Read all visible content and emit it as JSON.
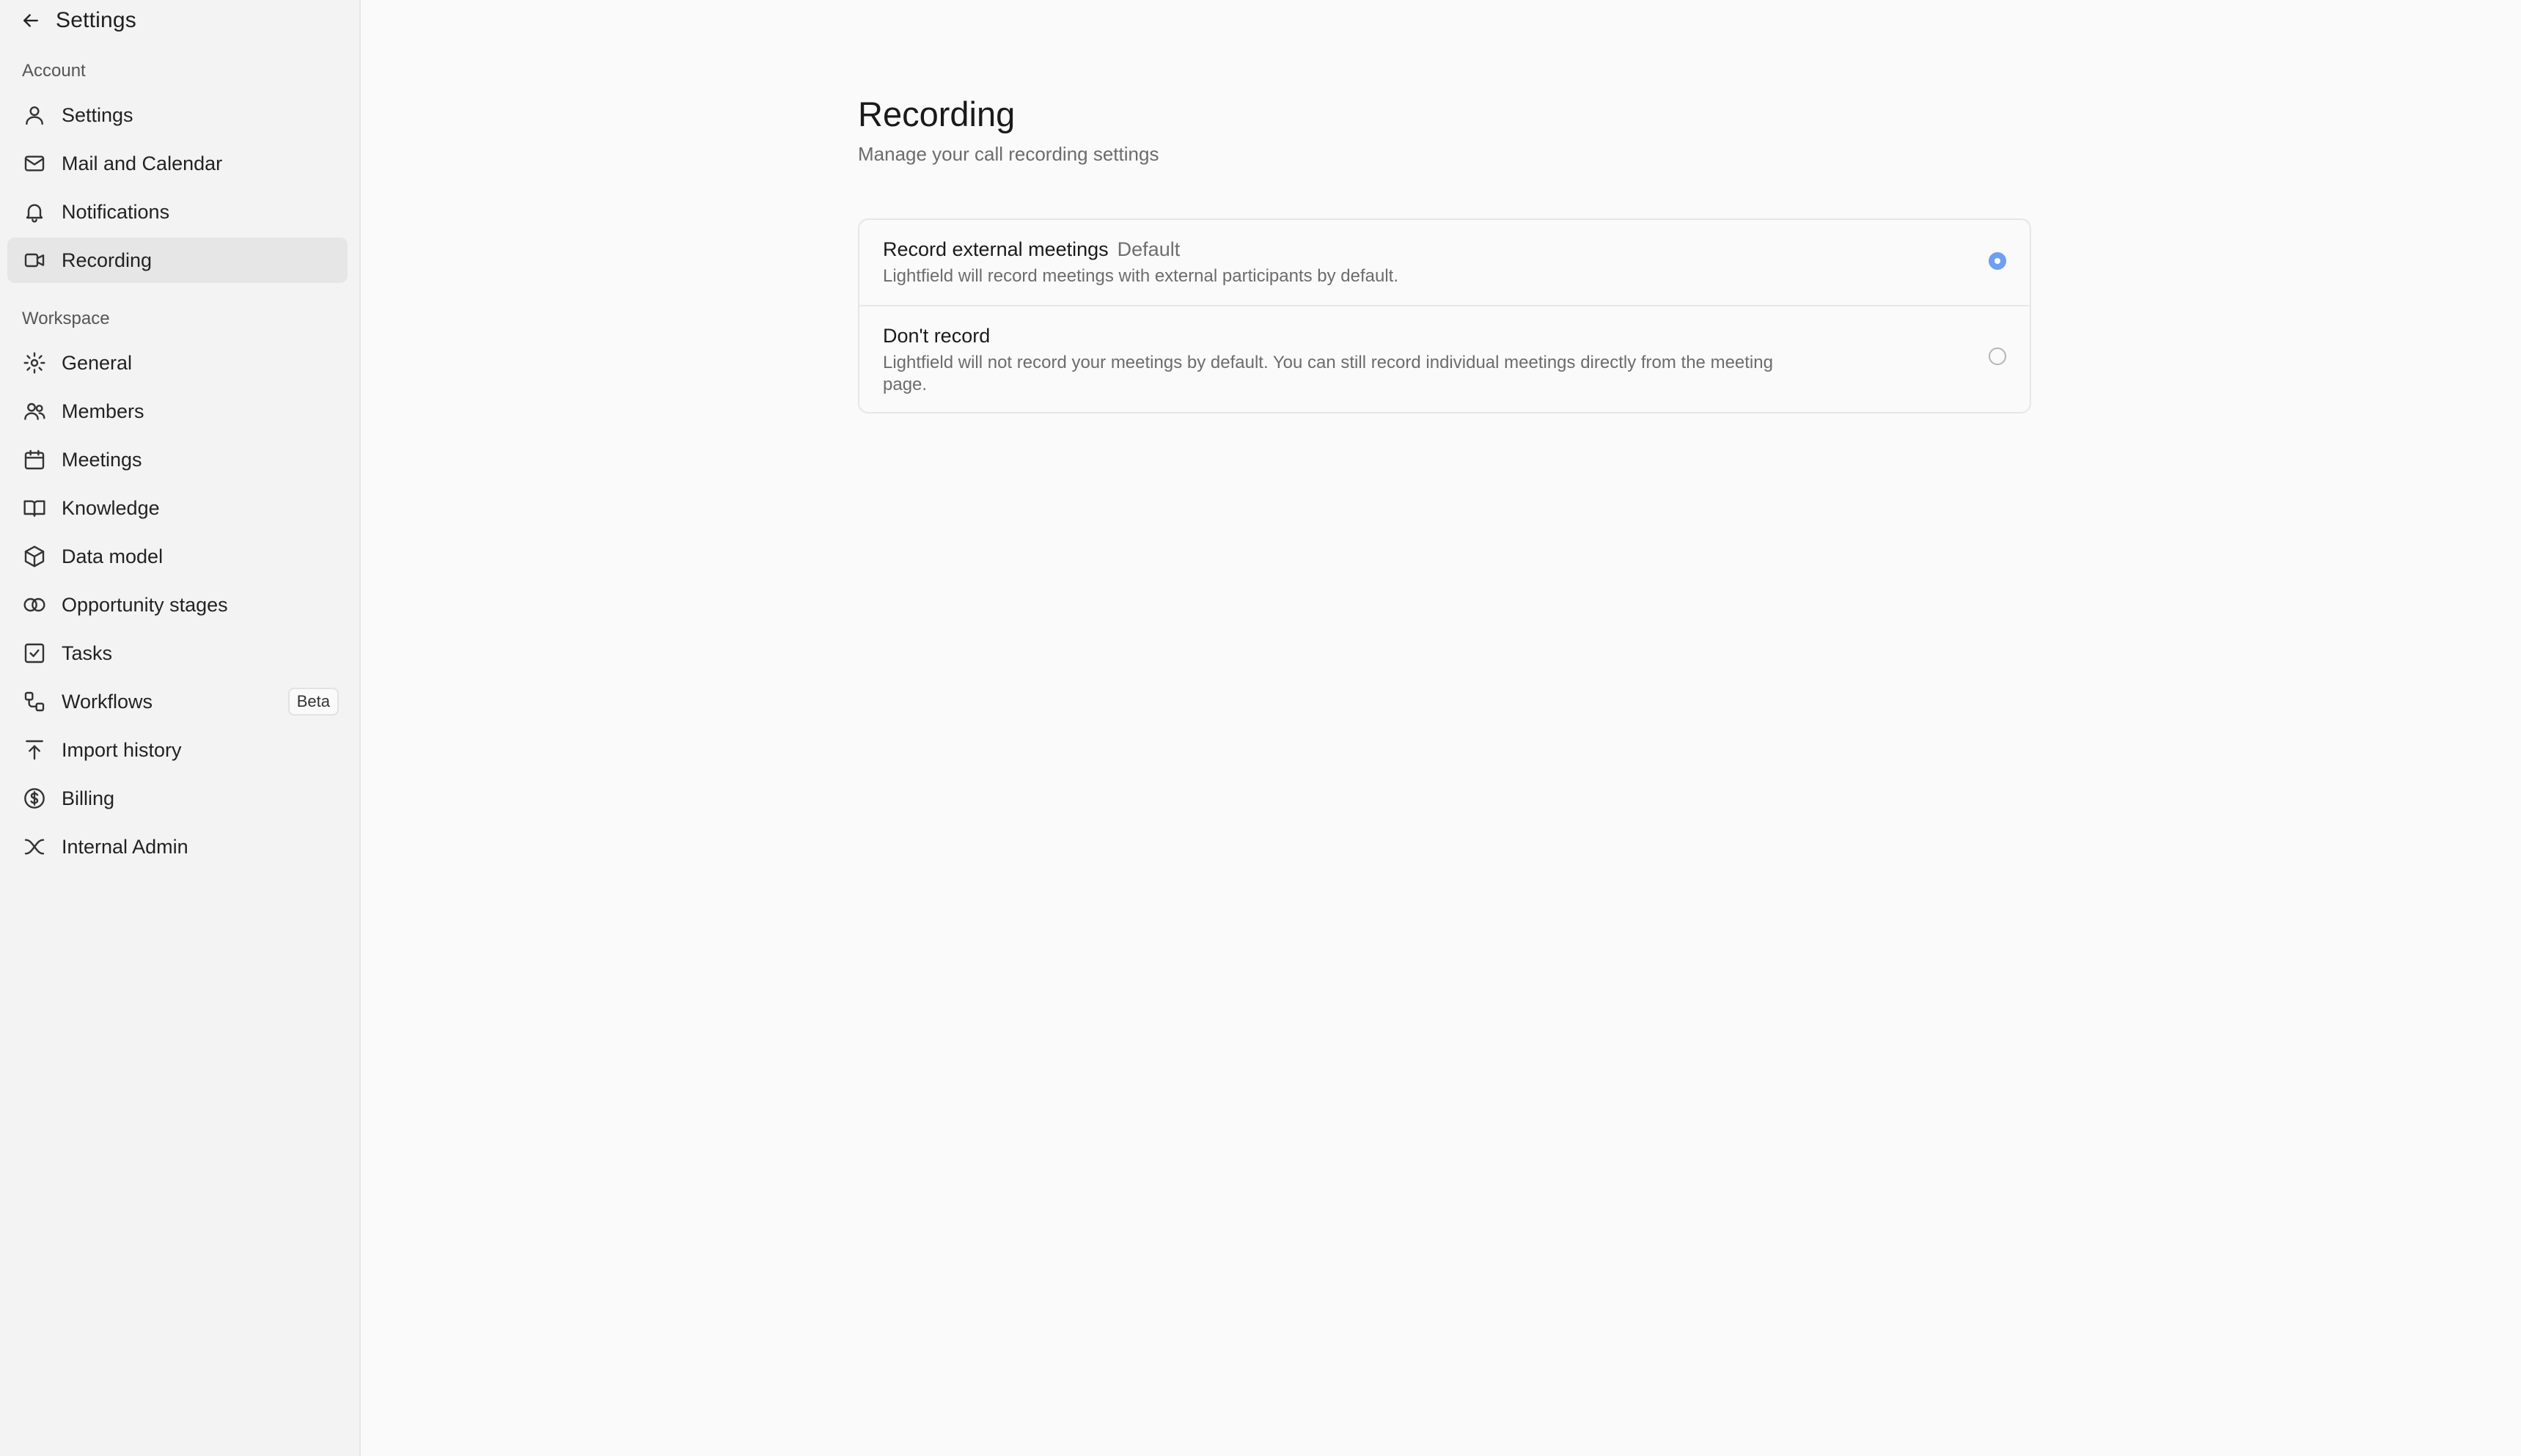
{
  "header": {
    "back_icon": "arrow-left-icon",
    "title": "Settings"
  },
  "sidebar": {
    "account_label": "Account",
    "workspace_label": "Workspace",
    "account_items": [
      {
        "label": "Settings",
        "icon": "user-icon"
      },
      {
        "label": "Mail and Calendar",
        "icon": "mail-icon"
      },
      {
        "label": "Notifications",
        "icon": "bell-icon"
      },
      {
        "label": "Recording",
        "icon": "video-icon",
        "active": true
      }
    ],
    "workspace_items": [
      {
        "label": "General",
        "icon": "gear-icon"
      },
      {
        "label": "Members",
        "icon": "users-icon"
      },
      {
        "label": "Meetings",
        "icon": "calendar-icon"
      },
      {
        "label": "Knowledge",
        "icon": "book-icon"
      },
      {
        "label": "Data model",
        "icon": "cube-icon"
      },
      {
        "label": "Opportunity stages",
        "icon": "circles-icon"
      },
      {
        "label": "Tasks",
        "icon": "checkbox-icon"
      },
      {
        "label": "Workflows",
        "icon": "workflow-icon",
        "badge": "Beta"
      },
      {
        "label": "Import history",
        "icon": "upload-icon"
      },
      {
        "label": "Billing",
        "icon": "dollar-icon"
      },
      {
        "label": "Internal Admin",
        "icon": "x-arrows-icon"
      }
    ]
  },
  "main": {
    "title": "Recording",
    "subtitle": "Manage your call recording settings",
    "options": [
      {
        "title": "Record external meetings",
        "tag": "Default",
        "description": "Lightfield will record meetings with external participants by default.",
        "selected": true
      },
      {
        "title": "Don't record",
        "tag": "",
        "description": "Lightfield will not record your meetings by default. You can still record individual meetings directly from the meeting page.",
        "selected": false
      }
    ]
  },
  "colors": {
    "sidebar_bg": "#f3f3f3",
    "main_bg": "#fafafa",
    "active_item_bg": "#e6e6e6",
    "radio_accent": "#6e9ff0"
  }
}
